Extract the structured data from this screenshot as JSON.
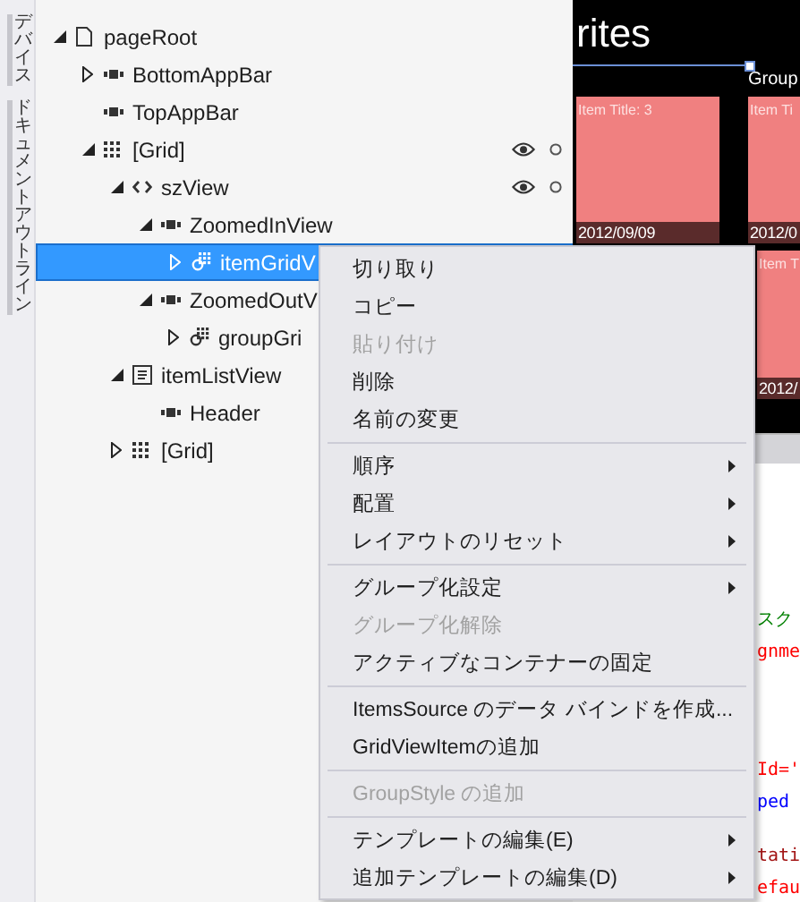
{
  "side_tabs": [
    {
      "label": "デバイス"
    },
    {
      "label": "ドキュメントアウトライン"
    }
  ],
  "tree": [
    {
      "label": "pageRoot",
      "kind": "page",
      "expanded": true,
      "selected": false,
      "visibility_icons": false,
      "children": [
        {
          "label": "BottomAppBar",
          "kind": "bar",
          "expanded": false,
          "selected": false,
          "visibility_icons": false
        },
        {
          "label": "TopAppBar",
          "kind": "bar",
          "selected": false,
          "visibility_icons": false
        },
        {
          "label": "[Grid]",
          "kind": "grid",
          "expanded": true,
          "selected": false,
          "visibility_icons": true,
          "children": [
            {
              "label": "szView",
              "kind": "zoom",
              "expanded": true,
              "selected": false,
              "visibility_icons": true,
              "children": [
                {
                  "label": "ZoomedInView",
                  "kind": "bar",
                  "expanded": true,
                  "selected": false,
                  "visibility_icons": false,
                  "children": [
                    {
                      "label": "itemGridV",
                      "kind": "gridview",
                      "expanded": false,
                      "selected": true
                    }
                  ]
                },
                {
                  "label": "ZoomedOutV",
                  "kind": "bar",
                  "expanded": true,
                  "selected": false,
                  "children": [
                    {
                      "label": "groupGri",
                      "kind": "gridview",
                      "expanded": false,
                      "selected": false
                    }
                  ]
                }
              ]
            },
            {
              "label": "itemListView",
              "kind": "list",
              "expanded": true,
              "selected": false,
              "children": [
                {
                  "label": "Header",
                  "kind": "bar",
                  "selected": false
                }
              ]
            },
            {
              "label": "[Grid]",
              "kind": "grid",
              "expanded": false,
              "selected": false
            }
          ]
        }
      ]
    }
  ],
  "designer": {
    "title": "rites",
    "group_label": "Group",
    "tiles": [
      {
        "title": "Item Title: 3",
        "date": "2012/09/09"
      },
      {
        "title": "Item Ti",
        "date": "2012/0"
      },
      {
        "title": "Item T",
        "date": "2012/"
      }
    ]
  },
  "code_fragments": [
    {
      "text": "スク",
      "color": "#008000"
    },
    {
      "text": "gnme",
      "color": "#ff0000"
    },
    {
      "text": "Id='",
      "color": "#ff0000"
    },
    {
      "text": "ped",
      "color": "#0000ff"
    },
    {
      "text": "tati",
      "color": "#a31515"
    },
    {
      "text": "efau",
      "color": "#ff0000"
    }
  ],
  "context_menu": [
    {
      "kind": "item",
      "label": "切り取り",
      "disabled": false,
      "submenu": false
    },
    {
      "kind": "item",
      "label": "コピー",
      "disabled": false,
      "submenu": false
    },
    {
      "kind": "item",
      "label": "貼り付け",
      "disabled": true,
      "submenu": false
    },
    {
      "kind": "item",
      "label": "削除",
      "disabled": false,
      "submenu": false
    },
    {
      "kind": "item",
      "label": "名前の変更",
      "disabled": false,
      "submenu": false
    },
    {
      "kind": "separator"
    },
    {
      "kind": "item",
      "label": "順序",
      "disabled": false,
      "submenu": true
    },
    {
      "kind": "item",
      "label": "配置",
      "disabled": false,
      "submenu": true
    },
    {
      "kind": "item",
      "label": "レイアウトのリセット",
      "disabled": false,
      "submenu": true
    },
    {
      "kind": "separator"
    },
    {
      "kind": "item",
      "label": "グループ化設定",
      "disabled": false,
      "submenu": true
    },
    {
      "kind": "item",
      "label": "グループ化解除",
      "disabled": true,
      "submenu": false
    },
    {
      "kind": "item",
      "label": "アクティブなコンテナーの固定",
      "disabled": false,
      "submenu": false
    },
    {
      "kind": "separator"
    },
    {
      "kind": "item",
      "label": "ItemsSource のデータ バインドを作成...",
      "disabled": false,
      "submenu": false
    },
    {
      "kind": "item",
      "label": "GridViewItemの追加",
      "disabled": false,
      "submenu": false
    },
    {
      "kind": "separator"
    },
    {
      "kind": "item",
      "label": "GroupStyle の追加",
      "disabled": true,
      "submenu": false
    },
    {
      "kind": "separator"
    },
    {
      "kind": "item",
      "label": "テンプレートの編集(E)",
      "disabled": false,
      "submenu": true
    },
    {
      "kind": "item",
      "label": "追加テンプレートの編集(D)",
      "disabled": false,
      "submenu": true
    }
  ]
}
